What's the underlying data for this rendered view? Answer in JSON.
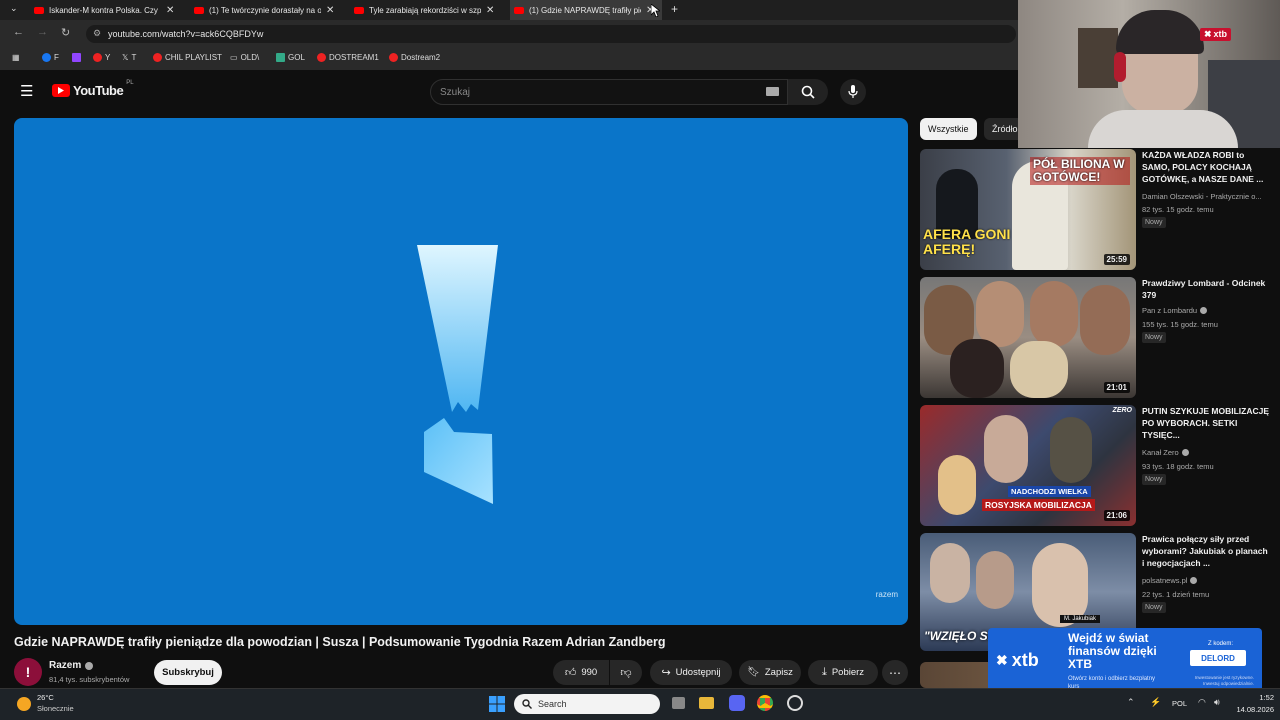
{
  "browser": {
    "tabs": [
      {
        "title": "Iskander-M kontra Polska. Czy"
      },
      {
        "title": "(1) Te twórczynie dorastały na o"
      },
      {
        "title": "Tyle zarabiają rekordziści w szp"
      },
      {
        "title": "(1) Gdzie NAPRAWDĘ trafiły pie"
      }
    ],
    "url": "youtube.com/watch?v=ack6CQBFDYw",
    "bookmarks": [
      "F",
      "Y",
      "T",
      "CHIL PLAYLIST",
      "OLD\\",
      "GOL",
      "DOSTREAM1",
      "Dostream2"
    ]
  },
  "youtube": {
    "logo": "YouTube",
    "logo_country": "PL",
    "search_placeholder": "Szukaj",
    "video": {
      "watermark": "razem",
      "title": "Gdzie NAPRAWDĘ trafiły pieniądze dla powodzian | Susza | Podsumowanie Tygodnia Razem Adrian Zandberg",
      "channel": "Razem",
      "subscribers": "81,4 tys. subskrybentów",
      "subscribe_label": "Subskrybuj",
      "likes": "990",
      "share_label": "Udostępnij",
      "save_label": "Zapisz",
      "download_label": "Pobierz"
    },
    "chips": [
      "Wszystkie",
      "Źródło"
    ],
    "recommendations": [
      {
        "title": "KAŻDA WŁADZA ROBI to SAMO, POLACY KOCHAJĄ GOTÓWKĘ, a NASZE DANE ...",
        "channel": "Damian Olszewski - Praktycznie o...",
        "meta": "82 tys.  15 godz. temu",
        "badge": "Nowy",
        "duration": "25:59",
        "thumb_text_top": "PÓŁ BILIONA W GOTÓWCE!",
        "thumb_text_bottom": "AFERA GONI AFERĘ!"
      },
      {
        "title": "Prawdziwy Lombard - Odcinek 379",
        "channel": "Pan z Lombardu",
        "meta": "155 tys.  15 godz. temu",
        "badge": "Nowy",
        "duration": "21:01"
      },
      {
        "title": "PUTIN SZYKUJE MOBILIZACJĘ PO WYBORACH. SETKI TYSIĘC...",
        "channel": "Kanał Zero",
        "meta": "93 tys.  18 godz. temu",
        "badge": "Nowy",
        "duration": "21:06",
        "thumb_text_top": "NADCHODZI WIELKA",
        "thumb_text_bottom": "ROSYJSKA MOBILIZACJA",
        "thumb_brand": "ZERO"
      },
      {
        "title": "Prawica połączy siły przed wyborami? Jakubiak o planach i negocjacjach ...",
        "channel": "polsatnews.pl",
        "meta": "22 tys.  1 dzień temu",
        "badge": "Nowy",
        "thumb_text_bottom": "\"WZIĘŁO SIĘ ZA PRACĘ\"",
        "thumb_name": "M. Jakubiak"
      }
    ]
  },
  "overlay": {
    "webcam_brand": "xtb",
    "ad": {
      "brand": "xtb",
      "headline": "Wejdź w świat finansów dzięki XTB",
      "sub": "Otwórz konto i odbierz bezpłatny kurs",
      "code_label": "Z kodem:",
      "code": "DELORD",
      "disclaimer": "Inwestowanie jest ryzykowne. Inwestuj odpowiedzialnie."
    }
  },
  "taskbar": {
    "weather_temp": "26°C",
    "weather_desc": "Słonecznie",
    "search_label": "Search",
    "lang": "POL",
    "time": "1:52",
    "date": "14.08.2026"
  },
  "colors": {
    "player_bg": "#0a75c9",
    "yt_red": "#ff0000",
    "xtb_blue": "#1a63d6"
  }
}
